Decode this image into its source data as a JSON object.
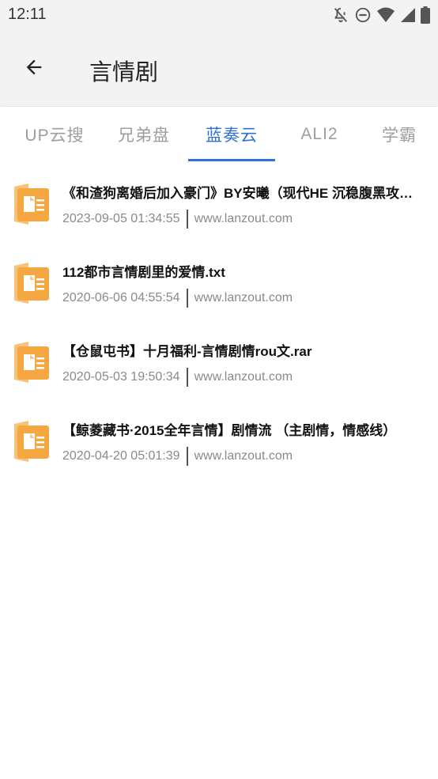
{
  "status_bar": {
    "time": "12:11"
  },
  "app_bar": {
    "title": "言情剧"
  },
  "tabs": [
    {
      "label": "UP云搜",
      "active": false
    },
    {
      "label": "兄弟盘",
      "active": false
    },
    {
      "label": "蓝奏云",
      "active": true
    },
    {
      "label": "ALI2",
      "active": false
    },
    {
      "label": "学霸",
      "active": false
    }
  ],
  "files": [
    {
      "name": "《和渣狗离婚后加入豪门》BY安曦（现代HE 沉稳腹黑攻x温柔美人受）",
      "date": "2023-09-05 01:34:55",
      "source": "www.lanzout.com"
    },
    {
      "name": "112都市言情剧里的爱情.txt",
      "date": "2020-06-06 04:55:54",
      "source": "www.lanzout.com"
    },
    {
      "name": "【仓鼠屯书】十月福利-言情剧情rou文.rar",
      "date": "2020-05-03 19:50:34",
      "source": "www.lanzout.com"
    },
    {
      "name": "【鲸菱藏书·2015全年言情】剧情流 （主剧情，情感线）",
      "date": "2020-04-20 05:01:39",
      "source": "www.lanzout.com"
    }
  ],
  "colors": {
    "accent": "#2f6fd6",
    "icon_orange": "#f5a742",
    "bar_bg": "#f3f3f3"
  },
  "icons": {
    "status": [
      "notifications-off-icon",
      "do-not-disturb-icon",
      "wifi-icon",
      "signal-icon",
      "battery-icon"
    ],
    "back": "arrow-back-icon",
    "file": "folder-document-icon"
  }
}
